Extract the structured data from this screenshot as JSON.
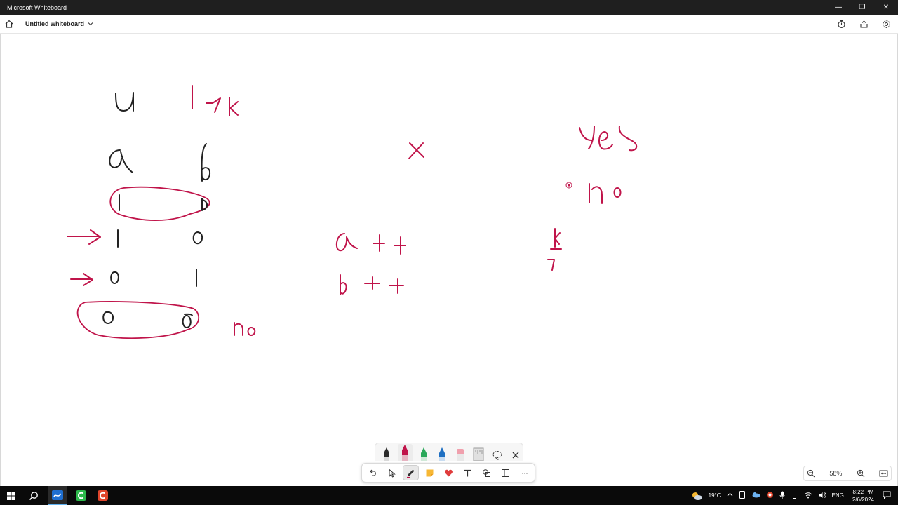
{
  "window": {
    "title": "Microsoft Whiteboard",
    "minimize_glyph": "—",
    "restore_glyph": "❐",
    "close_glyph": "✕"
  },
  "appbar": {
    "board_name": "Untitled whiteboard"
  },
  "canvas": {
    "ink_color": "#c0144a",
    "dark_ink_color": "#222222",
    "handwritten_strokes_read_as": [
      "u",
      "1→k",
      "a",
      "b",
      "1",
      "1",
      "→ 1",
      "0",
      "→ 0",
      "1",
      "0",
      "0",
      "no",
      "x",
      "a ++",
      "b ++",
      "yes",
      "no",
      "k",
      "7"
    ]
  },
  "pens": [
    {
      "name": "black-pen",
      "color": "#222222"
    },
    {
      "name": "red-pen",
      "color": "#c0144a"
    },
    {
      "name": "green-pen",
      "color": "#2aa85a"
    },
    {
      "name": "blue-pen",
      "color": "#1e6fc2"
    },
    {
      "name": "highlighter",
      "color": "#f08a9a"
    },
    {
      "name": "ruler",
      "color": "#9a9a9a"
    }
  ],
  "toolbar": {
    "tools": [
      "undo-icon",
      "select-icon",
      "pen-icon",
      "sticky-note-icon",
      "reaction-icon",
      "text-icon",
      "shapes-icon",
      "templates-icon",
      "more-icon"
    ],
    "more_glyph": "···"
  },
  "zoom": {
    "value": "58%"
  },
  "taskbar": {
    "weather_temp": "19°C",
    "language": "ENG",
    "time": "8:22 PM",
    "date": "2/6/2024"
  }
}
